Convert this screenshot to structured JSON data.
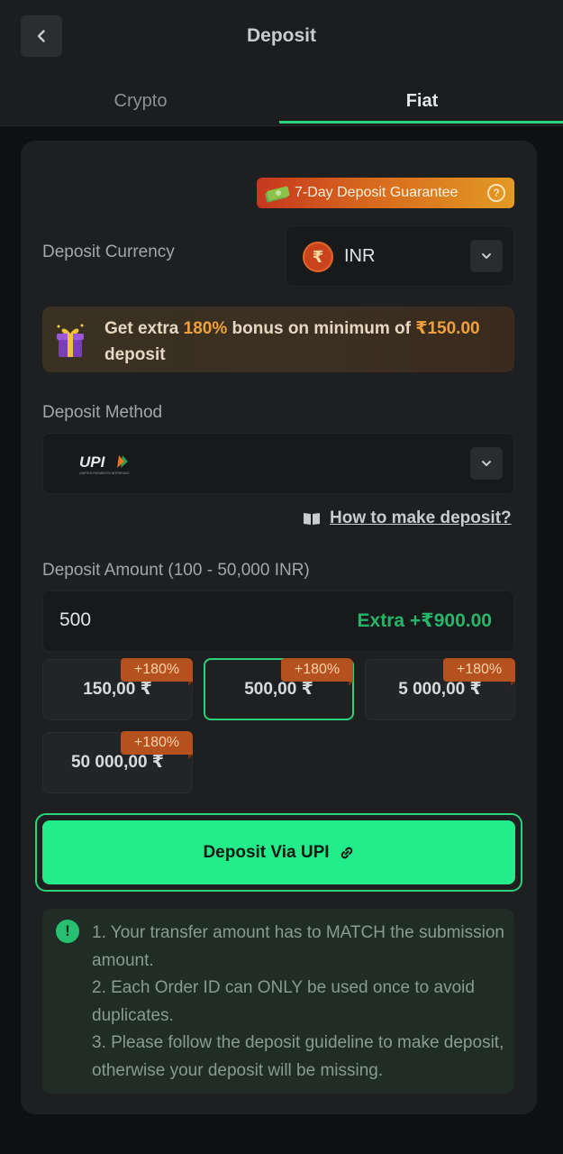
{
  "header": {
    "title": "Deposit"
  },
  "tabs": [
    {
      "label": "Crypto",
      "active": false
    },
    {
      "label": "Fiat",
      "active": true
    }
  ],
  "guarantee": {
    "label": "7-Day Deposit Guarantee",
    "help": "?"
  },
  "currency": {
    "label": "Deposit Currency",
    "code": "INR",
    "symbol": "₹"
  },
  "bonus": {
    "prefix": "Get extra ",
    "percent": "180%",
    "middle": " bonus on minimum of ",
    "minimum": "₹150.00",
    "suffix": " deposit"
  },
  "method": {
    "label": "Deposit Method",
    "logo_text": "UPI",
    "logo_subtext": "UNIFIED PAYMENTS INTERFACE"
  },
  "how_to": {
    "label": "How to make deposit?"
  },
  "amount": {
    "label": "Deposit Amount (100 - 50,000 INR)",
    "value": "500",
    "extra": "Extra +₹900.00"
  },
  "chips": [
    {
      "value": "150,00 ₹",
      "badge": "+180%",
      "selected": false
    },
    {
      "value": "500,00 ₹",
      "badge": "+180%",
      "selected": true
    },
    {
      "value": "5 000,00 ₹",
      "badge": "+180%",
      "selected": false
    },
    {
      "value": "50 000,00 ₹",
      "badge": "+180%",
      "selected": false
    }
  ],
  "deposit_button": {
    "label": "Deposit Via UPI"
  },
  "notice": {
    "icon": "!",
    "lines": [
      "1. Your transfer amount has to MATCH the submission amount.",
      "2. Each Order ID can ONLY be used once to avoid duplicates.",
      "3. Please follow the deposit guideline to make deposit, otherwise your deposit will be missing."
    ]
  },
  "colors": {
    "accent": "#23ec8b",
    "accent_border": "#2bd27c",
    "bonus_highlight": "#f0a13a",
    "badge": "#b5501f"
  }
}
